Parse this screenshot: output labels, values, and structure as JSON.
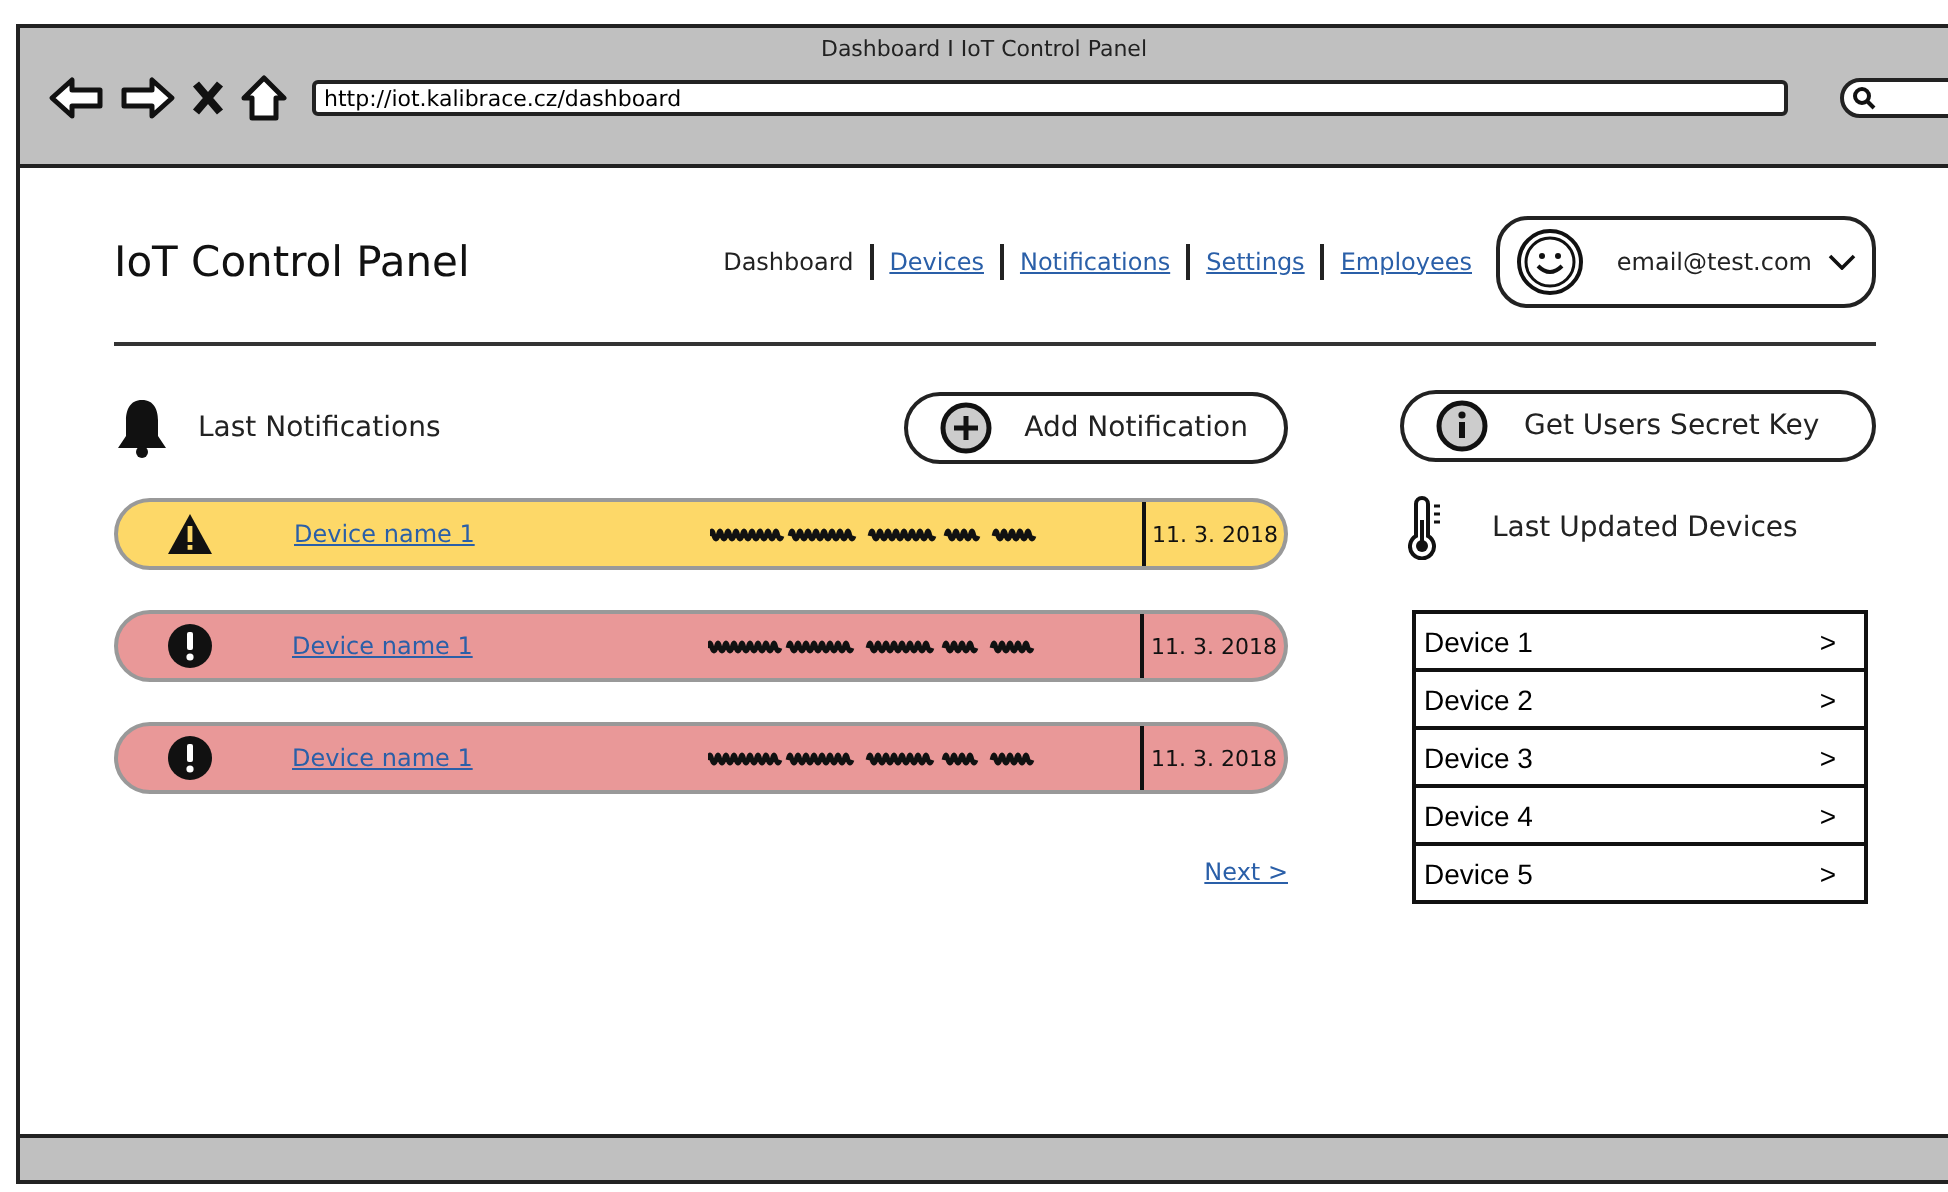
{
  "browser": {
    "title": "Dashboard I IoT Control Panel",
    "url": "http://iot.kalibrace.cz/dashboard"
  },
  "header": {
    "title": "IoT Control Panel",
    "nav": [
      {
        "label": "Dashboard",
        "selected": true
      },
      {
        "label": "Devices",
        "selected": false
      },
      {
        "label": "Notifications",
        "selected": false
      },
      {
        "label": "Settings",
        "selected": false
      },
      {
        "label": "Employees",
        "selected": false
      }
    ],
    "user": {
      "email": "email@test.com"
    }
  },
  "notifications": {
    "title": "Last Notifications",
    "add_button": "Add Notification",
    "items": [
      {
        "kind": "warning",
        "device": "Device name 1",
        "date": "11. 3. 2018"
      },
      {
        "kind": "error",
        "device": "Device name 1",
        "date": "11. 3. 2018"
      },
      {
        "kind": "error",
        "device": "Device name 1",
        "date": "11. 3. 2018"
      }
    ],
    "next": "Next >"
  },
  "side": {
    "key_button": "Get Users Secret Key",
    "devices_title": "Last Updated Devices",
    "devices": [
      {
        "name": "Device 1",
        "arrow": ">"
      },
      {
        "name": "Device 2",
        "arrow": ">"
      },
      {
        "name": "Device 3",
        "arrow": ">"
      },
      {
        "name": "Device 4",
        "arrow": ">"
      },
      {
        "name": "Device 5",
        "arrow": ">"
      }
    ]
  }
}
